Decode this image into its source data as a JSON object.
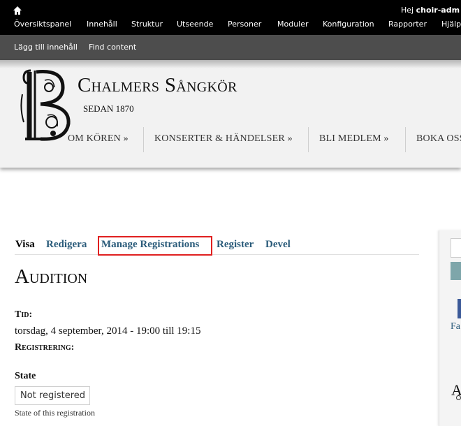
{
  "admin_bar": {
    "greeting_prefix": "Hej",
    "username": "choir-adm",
    "menu": [
      "Översiktspanel",
      "Innehåll",
      "Struktur",
      "Utseende",
      "Personer",
      "Moduler",
      "Konfiguration",
      "Rapporter",
      "Hjälp"
    ]
  },
  "shortcuts": [
    "Lägg till innehåll",
    "Find content"
  ],
  "site": {
    "name": "Chalmers Sångkör",
    "slogan": "SEDAN 1870"
  },
  "nav": [
    "OM KÖREN »",
    "KONSERTER & HÄNDELSER »",
    "BLI MEDLEM »",
    "BOKA OSS"
  ],
  "tabs": [
    "Visa",
    "Redigera",
    "Manage Registrations",
    "Register",
    "Devel"
  ],
  "page": {
    "title": "Audition",
    "time_label": "Tid:",
    "time_value": "torsdag, 4 september, 2014 - 19:00 till 19:15",
    "registration_label": "Registrering:",
    "state_label": "State",
    "state_value": "Not registered",
    "state_description": "State of this registration"
  },
  "sidebar": {
    "text_fragment": "Fa",
    "heading_fragment": "A"
  },
  "colors": {
    "admin_bg": "#000000",
    "shortcut_bg": "#4d4d4d",
    "tab_link": "#2a5b7a",
    "highlight": "#e02020"
  }
}
